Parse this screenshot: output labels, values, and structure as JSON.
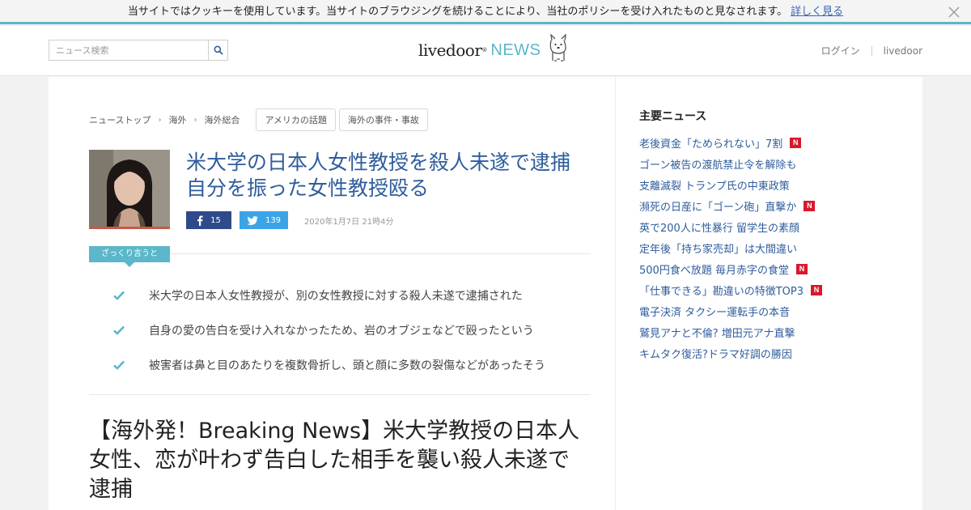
{
  "cookie": {
    "message": "当サイトではクッキーを使用しています。当サイトのブラウジングを続けることにより、当社のポリシーを受け入れたものと見なされます。",
    "link_label": "詳しく見る"
  },
  "header": {
    "search_placeholder": "ニュース検索",
    "logo_main": "livedoor",
    "logo_news": "NEWS",
    "login_label": "ログイン",
    "livedoor_label": "livedoor"
  },
  "breadcrumb": {
    "items": [
      "ニューストップ",
      "海外",
      "海外総合"
    ],
    "tags": [
      "アメリカの話題",
      "海外の事件・事故"
    ]
  },
  "article": {
    "title_line1": "米大学の日本人女性教授を殺人未遂で逮捕",
    "title_line2": "自分を振った女性教授殴る",
    "facebook_count": "15",
    "twitter_count": "139",
    "date": "2020年1月7日 21時4分",
    "summary_label": "ざっくり言うと",
    "summary": [
      "米大学の日本人女性教授が、別の女性教授に対する殺人未遂で逮捕された",
      "自身の愛の告白を受け入れなかったため、岩のオブジェなどで殴ったという",
      "被害者は鼻と目のあたりを複数骨折し、頭と顔に多数の裂傷などがあったそう"
    ],
    "subhead": "【海外発！Breaking News】米大学教授の日本人女性、恋が叶わず告白した相手を襲い殺人未遂で逮捕"
  },
  "sidebar": {
    "title": "主要ニュース",
    "news": [
      {
        "text": "老後資金「ためられない」7割",
        "badge": "N"
      },
      {
        "text": "ゴーン被告の渡航禁止令を解除も",
        "badge": ""
      },
      {
        "text": "支離滅裂 トランプ氏の中東政策",
        "badge": ""
      },
      {
        "text": "瀕死の日産に「ゴーン砲」直撃か",
        "badge": "N"
      },
      {
        "text": "英で200人に性暴行 留学生の素顔",
        "badge": ""
      },
      {
        "text": "定年後「持ち家売却」は大間違い",
        "badge": ""
      },
      {
        "text": "500円食べ放題 毎月赤字の食堂",
        "badge": "N"
      },
      {
        "text": "「仕事できる」勘違いの特徴TOP3",
        "badge": "N"
      },
      {
        "text": "電子決済 タクシー運転手の本音",
        "badge": ""
      },
      {
        "text": "鷲見アナと不倫? 増田元アナ直撃",
        "badge": ""
      },
      {
        "text": "キムタク復活?ドラマ好調の勝因",
        "badge": ""
      }
    ]
  },
  "colors": {
    "accent": "#5bb7c9",
    "link": "#2f5d9c",
    "badge": "#d9182d",
    "facebook": "#2f4a8a",
    "twitter": "#3aa4e6"
  },
  "icons": {
    "search": "search-icon",
    "close": "close-icon",
    "facebook": "facebook-icon",
    "twitter": "twitter-icon",
    "check": "check-icon"
  }
}
